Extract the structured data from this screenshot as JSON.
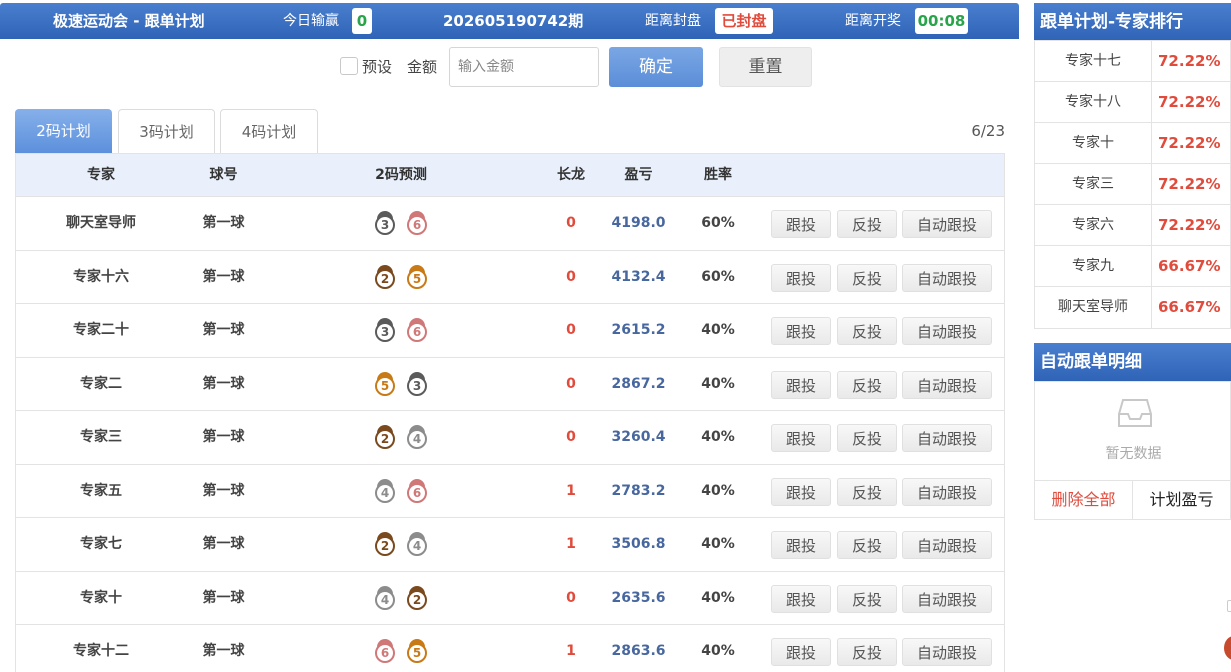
{
  "header": {
    "title": "极速运动会 - 跟单计划",
    "today_label": "今日输赢",
    "today_value": "0",
    "period": "202605190742期",
    "close_label": "距离封盘",
    "close_value": "已封盘",
    "draw_label": "距离开奖",
    "draw_value": "00:08"
  },
  "controls": {
    "preset_label": "预设",
    "amount_label": "金额",
    "amount_placeholder": "输入金额",
    "confirm_label": "确定",
    "reset_label": "重置"
  },
  "tabs": [
    {
      "label": "2码计划",
      "active": true
    },
    {
      "label": "3码计划",
      "active": false
    },
    {
      "label": "4码计划",
      "active": false
    }
  ],
  "pager": "6/23",
  "table": {
    "headers": {
      "expert": "专家",
      "ball": "球号",
      "pred": "2码预测",
      "dragon": "长龙",
      "profit": "盈亏",
      "rate": "胜率"
    },
    "btn_follow": "跟投",
    "btn_reverse": "反投",
    "btn_auto": "自动跟投",
    "rows": [
      {
        "expert": "聊天室导师",
        "ball": "第一球",
        "pred": [
          "3",
          "6"
        ],
        "dragon": "0",
        "profit": "4198.0",
        "rate": "60%"
      },
      {
        "expert": "专家十六",
        "ball": "第一球",
        "pred": [
          "2",
          "5"
        ],
        "dragon": "0",
        "profit": "4132.4",
        "rate": "60%"
      },
      {
        "expert": "专家二十",
        "ball": "第一球",
        "pred": [
          "3",
          "6"
        ],
        "dragon": "0",
        "profit": "2615.2",
        "rate": "40%"
      },
      {
        "expert": "专家二",
        "ball": "第一球",
        "pred": [
          "5",
          "3"
        ],
        "dragon": "0",
        "profit": "2867.2",
        "rate": "40%"
      },
      {
        "expert": "专家三",
        "ball": "第一球",
        "pred": [
          "2",
          "4"
        ],
        "dragon": "0",
        "profit": "3260.4",
        "rate": "40%"
      },
      {
        "expert": "专家五",
        "ball": "第一球",
        "pred": [
          "4",
          "6"
        ],
        "dragon": "1",
        "profit": "2783.2",
        "rate": "40%"
      },
      {
        "expert": "专家七",
        "ball": "第一球",
        "pred": [
          "2",
          "4"
        ],
        "dragon": "1",
        "profit": "3506.8",
        "rate": "40%"
      },
      {
        "expert": "专家十",
        "ball": "第一球",
        "pred": [
          "4",
          "2"
        ],
        "dragon": "0",
        "profit": "2635.6",
        "rate": "40%"
      },
      {
        "expert": "专家十二",
        "ball": "第一球",
        "pred": [
          "6",
          "5"
        ],
        "dragon": "1",
        "profit": "2863.6",
        "rate": "40%"
      }
    ]
  },
  "ranking": {
    "title": "跟单计划-专家排行",
    "items": [
      {
        "name": "专家十七",
        "rate": "72.22%"
      },
      {
        "name": "专家十八",
        "rate": "72.22%"
      },
      {
        "name": "专家十",
        "rate": "72.22%"
      },
      {
        "name": "专家三",
        "rate": "72.22%"
      },
      {
        "name": "专家六",
        "rate": "72.22%"
      },
      {
        "name": "专家九",
        "rate": "66.67%"
      },
      {
        "name": "聊天室导师",
        "rate": "66.67%"
      }
    ]
  },
  "auto_detail": {
    "title": "自动跟单明细",
    "empty_text": "暂无数据",
    "delete_all": "删除全部",
    "plan_profit": "计划盈亏"
  },
  "icons": {
    "zodiac_colors": {
      "2": "#7a4a1e",
      "3": "#5b5b5b",
      "4": "#8c8c8c",
      "5": "#c77a16",
      "6": "#d07878"
    }
  }
}
